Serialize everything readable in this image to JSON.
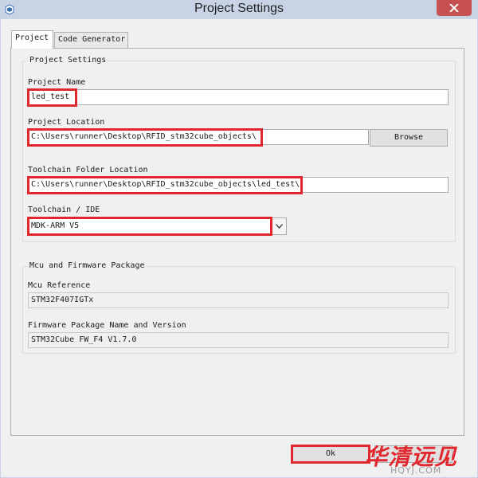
{
  "window": {
    "title": "Project Settings"
  },
  "tabs": [
    {
      "label": "Project"
    },
    {
      "label": "Code Generator"
    }
  ],
  "project_settings": {
    "group_title": "Project Settings",
    "project_name": {
      "label": "Project Name",
      "value": "led_test"
    },
    "project_location": {
      "label": "Project Location",
      "value": "C:\\Users\\runner\\Desktop\\RFID_stm32cube_objects\\",
      "browse_label": "Browse"
    },
    "toolchain_folder": {
      "label": "Toolchain Folder Location",
      "value": "C:\\Users\\runner\\Desktop\\RFID_stm32cube_objects\\led_test\\"
    },
    "toolchain_ide": {
      "label": "Toolchain / IDE",
      "selected": "MDK-ARM V5"
    }
  },
  "mcu_firmware": {
    "group_title": "Mcu and Firmware Package",
    "mcu_reference": {
      "label": "Mcu Reference",
      "value": "STM32F407IGTx"
    },
    "firmware_package": {
      "label": "Firmware Package Name and Version",
      "value": "STM32Cube FW_F4 V1.7.0"
    }
  },
  "footer": {
    "ok_label": "Ok"
  },
  "watermark": {
    "text": "华清远见",
    "sub": "HQYJ.COM"
  },
  "colors": {
    "highlight": "#e0282e",
    "titlebar": "#c9d3e6",
    "close_button": "#c75050"
  }
}
